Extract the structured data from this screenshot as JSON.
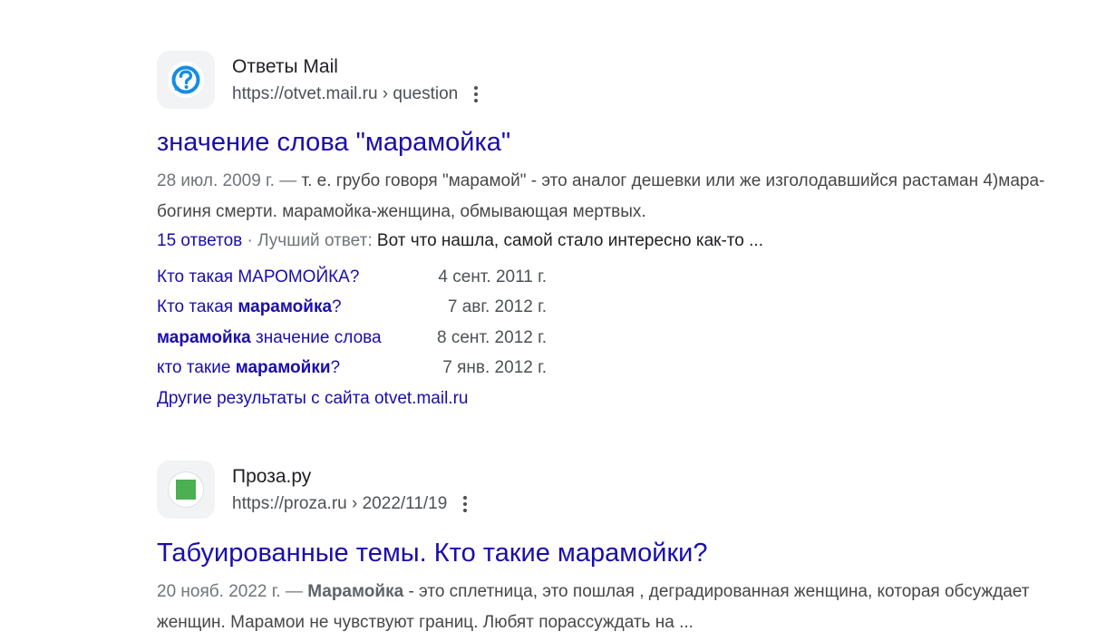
{
  "results": [
    {
      "site_name": "Ответы Mail",
      "url": "https://otvet.mail.ru › question",
      "favicon": "question-circle-icon",
      "favicon_color": "#168de2",
      "title": "значение слова \"марамойка\"",
      "snippet_date": "28 июл. 2009 г. —",
      "snippet_text": " т. е. грубо говоря \"марамой\" - это аналог дешевки или же изголодавшийся растаман 4)мара- богиня смерти. марамойка-женщина, обмывающая мертвых.",
      "answers_link": "15 ответов",
      "separator": " · ",
      "best_answer_label": "Лучший ответ: ",
      "best_answer_text": "Вот что нашла, самой стало интересно как-то ...",
      "sitelinks": [
        {
          "pre": "Кто такая МАРОМОЙКА?",
          "bold": "",
          "post": "",
          "date": "4 сент. 2011 г."
        },
        {
          "pre": "Кто такая ",
          "bold": "марамойка",
          "post": "?",
          "date": "7 авг. 2012 г."
        },
        {
          "pre": "",
          "bold": "марамойка",
          "post": " значение слова",
          "date": "8 сент. 2012 г."
        },
        {
          "pre": "кто такие ",
          "bold": "марамойки",
          "post": "?",
          "date": "7 янв. 2012 г."
        }
      ],
      "more_results": "Другие результаты с сайта otvet.mail.ru"
    },
    {
      "site_name": "Проза.ру",
      "url": "https://proza.ru › 2022/11/19",
      "favicon": "green-square-icon",
      "favicon_color": "#4caf50",
      "title": "Табуированные темы. Кто такие марамойки?",
      "snippet_date": "20 нояб. 2022 г. —",
      "snippet_bold": "Марамойка",
      "snippet_text": " - это сплетница, это пошлая , деградированная женщина, которая обсуждает женщин. Марамои не чувствуют границ. Любят порассуждать на ..."
    }
  ]
}
